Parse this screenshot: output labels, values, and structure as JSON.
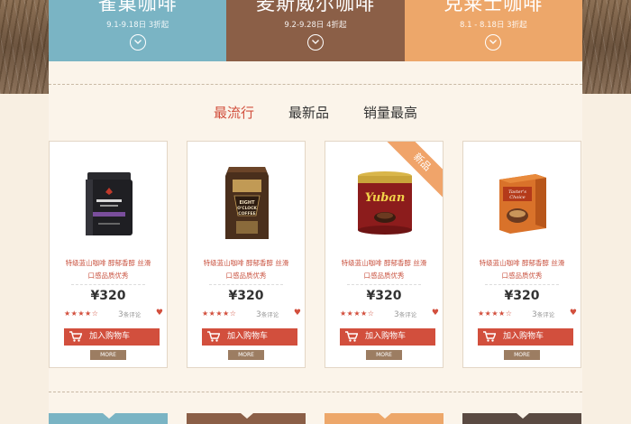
{
  "banners": [
    {
      "title": "雀巢咖啡",
      "subtitle": "9.1-9.18日  3折起",
      "color": "#7ab4c4"
    },
    {
      "title": "麦斯威尔咖啡",
      "subtitle": "9.2-9.28日  4折起",
      "color": "#8b5f47"
    },
    {
      "title": "克莱士咖啡",
      "subtitle": "8.1 - 8.18日  3折起",
      "color": "#eda76a"
    }
  ],
  "tabs": [
    {
      "label": "最流行",
      "active": true
    },
    {
      "label": "最新品",
      "active": false
    },
    {
      "label": "销量最高",
      "active": false
    }
  ],
  "products": [
    {
      "desc1": "特级蓝山咖啡  醇郁香醇 丝滑",
      "desc2": "口感品质优秀",
      "price": "¥320",
      "stars": "★★★★☆",
      "reviews_num": "3",
      "reviews_unit": "条评论",
      "cart_label": "加入购物车",
      "more_label": "MORE",
      "badge": ""
    },
    {
      "desc1": "特级蓝山咖啡  醇郁香醇 丝滑",
      "desc2": "口感品质优秀",
      "price": "¥320",
      "stars": "★★★★☆",
      "reviews_num": "3",
      "reviews_unit": "条评论",
      "cart_label": "加入购物车",
      "more_label": "MORE",
      "badge": ""
    },
    {
      "desc1": "特级蓝山咖啡  醇郁香醇 丝滑",
      "desc2": "口感品质优秀",
      "price": "¥320",
      "stars": "★★★★☆",
      "reviews_num": "3",
      "reviews_unit": "条评论",
      "cart_label": "加入购物车",
      "more_label": "MORE",
      "badge": "新品"
    },
    {
      "desc1": "特级蓝山咖啡  醇郁香醇 丝滑",
      "desc2": "口感品质优秀",
      "price": "¥320",
      "stars": "★★★★☆",
      "reviews_num": "3",
      "reviews_unit": "条评论",
      "cart_label": "加入购物车",
      "more_label": "MORE",
      "badge": ""
    }
  ],
  "bottom_colors": [
    "#7ab4c4",
    "#8b5f47",
    "#eda76a",
    "#5a4a42"
  ]
}
